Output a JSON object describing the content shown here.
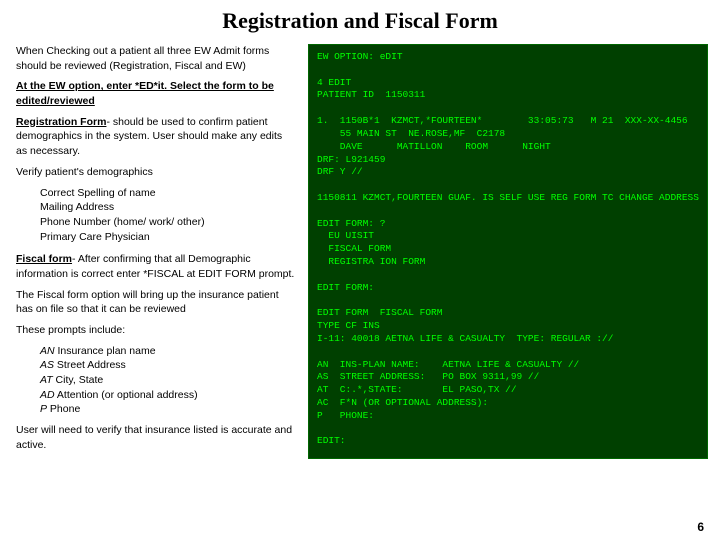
{
  "title": "Registration and Fiscal Form",
  "left": {
    "intro": "When Checking out a patient all three EW Admit forms should be reviewed (Registration, Fiscal and EW)",
    "ew_heading": "At the EW option, enter *ED*it. Select the form to be edited/reviewed",
    "reg_form_label": "Registration Form",
    "reg_form_text": "- should be used to confirm patient demographics in the system. User should make any edits as necessary.",
    "verify_heading": "Verify patient's demographics",
    "verify_items": [
      "Correct Spelling of name",
      "Mailing Address",
      "Phone Number (home/ work/ other)",
      "Primary Care Physician"
    ],
    "fiscal_label": "Fiscal form",
    "fiscal_text": "-  After confirming that all Demographic information is correct enter *FISCAL at EDIT FORM prompt.",
    "fiscal_note": "The Fiscal form option will bring up the insurance patient has on file so that it can be reviewed",
    "prompts_heading": "These prompts include:",
    "prompts": [
      {
        "code": "AN",
        "desc": "Insurance plan name"
      },
      {
        "code": "AS",
        "desc": "Street Address"
      },
      {
        "code": "AT",
        "desc": "City, State"
      },
      {
        "code": "AD",
        "desc": "Attention (or optional address)"
      },
      {
        "code": "P",
        "desc": "Phone"
      }
    ],
    "user_note": "User will need to verify that insurance listed is accurate and active."
  },
  "terminal": {
    "lines": [
      "EW OPTION: eDIT",
      "",
      "4 EDIT",
      "PATIENT ID  1150311",
      "",
      "1.  1150B*1  KZMCT,*FOURTEEN*        33:05:73   M 21  XXX-XX-4456",
      "    55 MAIN ST  NE.ROSE,MF  C2178",
      "    DAVE      MATILLON    ROOM      NIGHT",
      "DRF: L921459",
      "DRF Y //",
      "",
      "1150811 KZMCT,FOURTEEN GUAF. IS SELF USE REG FORM TC CHANGE ADDRESS",
      "",
      "EDIT FORM: ?",
      "  EU UISIT",
      "  FISCAL FORM",
      "  REGISTRA ION FORM",
      "",
      "EDIT FORM:",
      "",
      "EDIT FORM  FISCAL FORM",
      "TYPE CF INS",
      "I-11: 40018 AETNA LIFE & CASUALTY  TYPE: REGULAR ://",
      "",
      "AN  INS-PLAN NAME:    AETNA LIFE & CASUALTY //",
      "AS  STREET ADDRESS:   PO BOX 9311,99 //",
      "AT  C:.*,STATE:       EL PASO,TX //",
      "AC  F*N (OR OPTIONAL ADDRESS):",
      "P   PHONE:",
      "",
      "EDIT:"
    ]
  },
  "page_number": "6"
}
